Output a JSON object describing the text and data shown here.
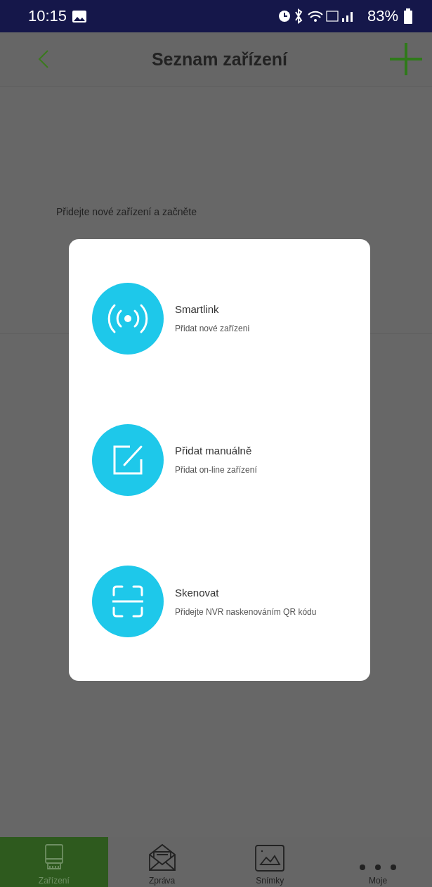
{
  "status_bar": {
    "time": "10:15",
    "battery": "83%"
  },
  "header": {
    "title": "Seznam zařízení"
  },
  "empty_message": "Přidejte nové zařízení a začněte",
  "dialog": {
    "options": [
      {
        "kind": "smartlink",
        "title": "Smartlink",
        "subtitle": "Přidat nové zařízeni"
      },
      {
        "kind": "manual",
        "title": "Přidat manuálně",
        "subtitle": "Přidat on-line zařízení"
      },
      {
        "kind": "scan",
        "title": "Skenovat",
        "subtitle": "Přidejte NVR naskenováním QR kódu"
      }
    ]
  },
  "tabs": [
    {
      "kind": "device",
      "label": "Zařízení",
      "selected": true
    },
    {
      "kind": "message",
      "label": "Zpráva",
      "selected": false
    },
    {
      "kind": "snapshot",
      "label": "Snímky",
      "selected": false
    },
    {
      "kind": "more",
      "label": "Moje",
      "selected": false
    }
  ]
}
